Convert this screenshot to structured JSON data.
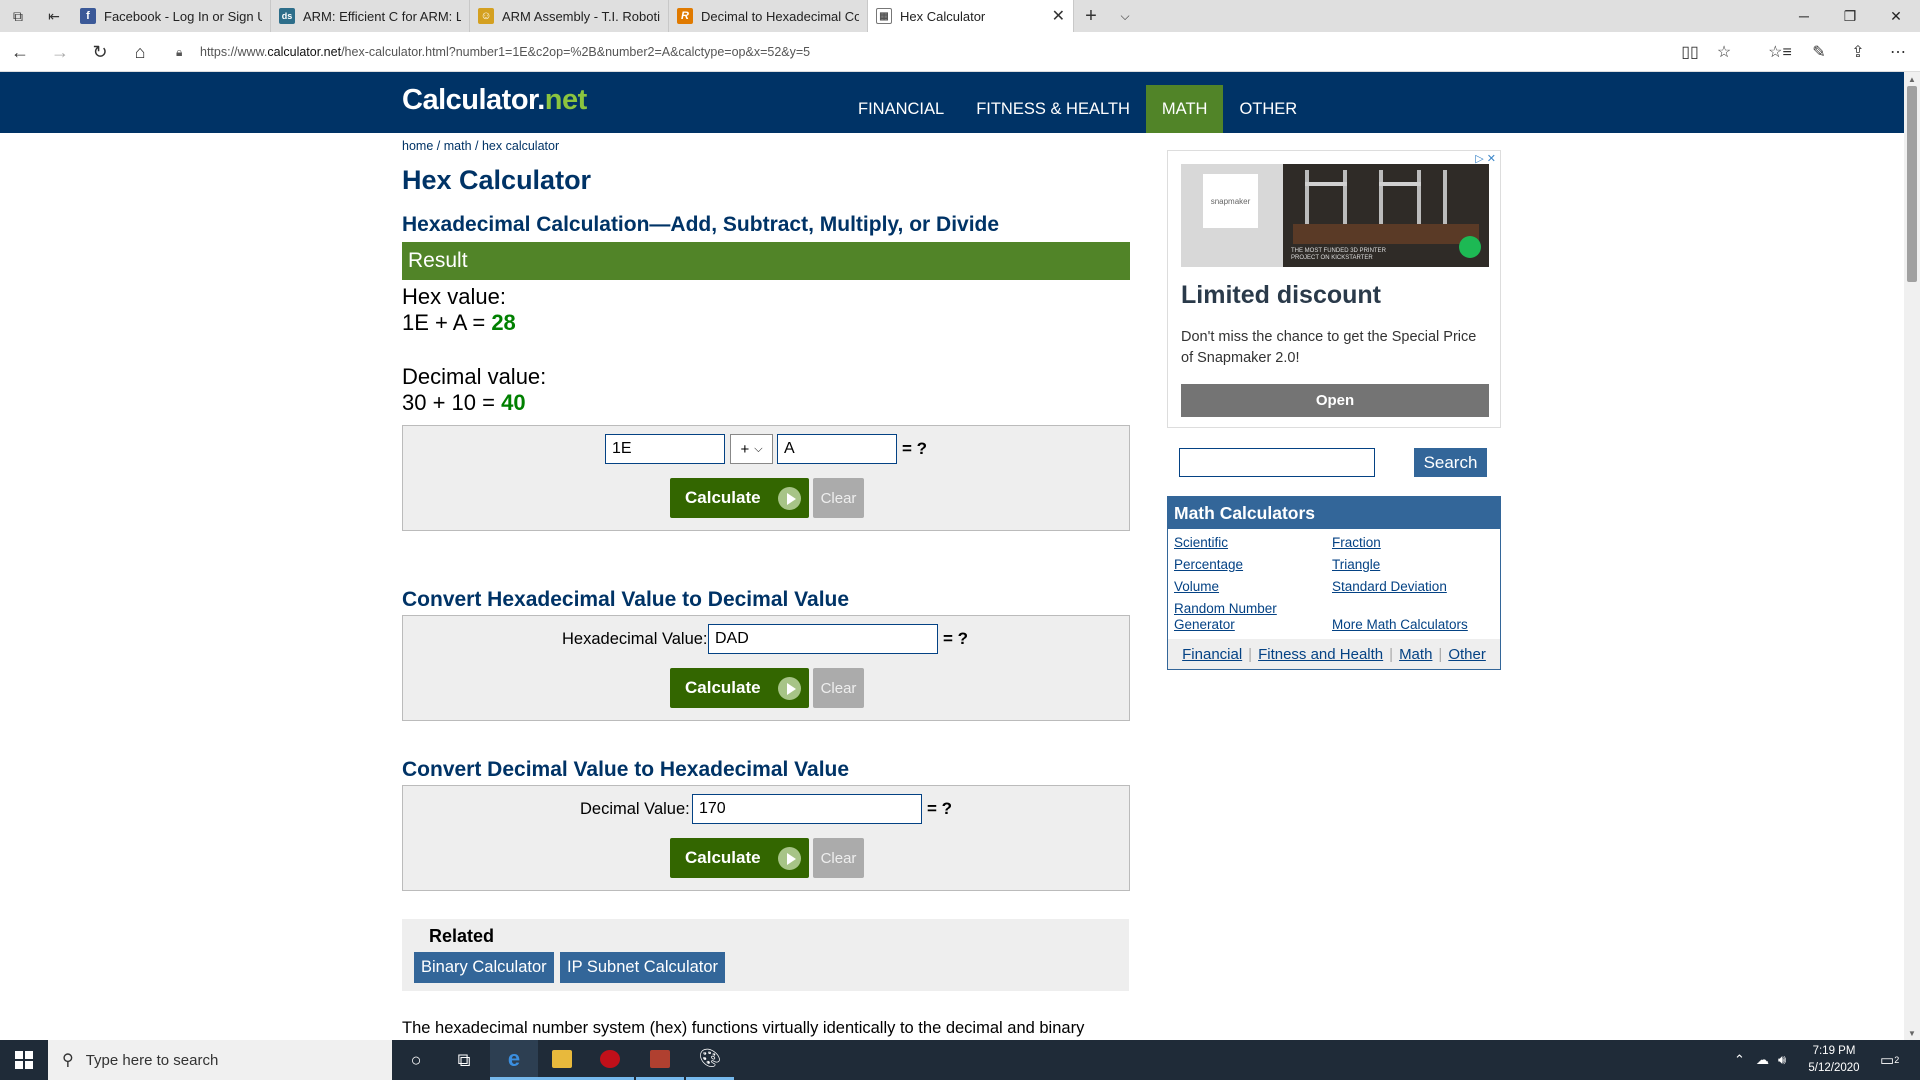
{
  "browser": {
    "tabs": [
      {
        "title": "Facebook - Log In or Sign U",
        "favicon": "facebook-icon",
        "color": "#3b5998",
        "glyph": "f"
      },
      {
        "title": "ARM: Efficient C for ARM: Lc",
        "favicon": "arm-icon",
        "color": "#2d6e8a",
        "glyph": "ds"
      },
      {
        "title": "ARM Assembly - T.I. Robotic",
        "favicon": "robot-icon",
        "color": "#d4a020",
        "glyph": "☺"
      },
      {
        "title": "Decimal to Hexadecimal Co",
        "favicon": "rapidtables-icon",
        "color": "#e07a00",
        "glyph": "R"
      },
      {
        "title": "Hex Calculator",
        "favicon": "calculator-page-icon",
        "color": "#555555",
        "glyph": "▦"
      }
    ],
    "url_prefix": "https://www.",
    "url_domain": "calculator.net",
    "url_path": "/hex-calculator.html?number1=1E&c2op=%2B&number2=A&calctype=op&x=52&y=5"
  },
  "site": {
    "logo_main": "Calculator",
    "logo_dot": ".",
    "logo_net": "net",
    "nav": [
      "FINANCIAL",
      "FITNESS & HEALTH",
      "MATH",
      "OTHER"
    ],
    "nav_active": "MATH"
  },
  "breadcrumb": {
    "home": "home",
    "sep": "/",
    "math": "math",
    "current": "hex calculator"
  },
  "page_title": "Hex Calculator",
  "calc_subtitle": "Hexadecimal Calculation—Add, Subtract, Multiply, or Divide",
  "result": {
    "bar_label": "Result",
    "hex_label": "Hex value:",
    "hex_expr": "1E + A = ",
    "hex_answer": "28",
    "dec_label": "Decimal value:",
    "dec_expr": "30 + 10 = ",
    "dec_answer": "40"
  },
  "calc1": {
    "number1": "1E",
    "operator": "+",
    "number2": "A",
    "equals": "= ?",
    "calculate": "Calculate",
    "clear": "Clear"
  },
  "convert_hex": {
    "title": "Convert Hexadecimal Value to Decimal Value",
    "label": "Hexadecimal Value:",
    "value": "DAD",
    "equals": "= ?",
    "calculate": "Calculate",
    "clear": "Clear"
  },
  "convert_dec": {
    "title": "Convert Decimal Value to Hexadecimal Value",
    "label": "Decimal Value:",
    "value": "170",
    "equals": "= ?",
    "calculate": "Calculate",
    "clear": "Clear"
  },
  "related": {
    "title": "Related",
    "links": [
      "Binary Calculator",
      "IP Subnet Calculator"
    ]
  },
  "intro_text": "The hexadecimal number system (hex) functions virtually identically to the decimal and binary",
  "ad": {
    "brand": "snapmaker",
    "caption1": "THE MOST FUNDED 3D PRINTER",
    "caption2": "PROJECT ON KICKSTARTER",
    "headline": "Limited discount",
    "text": "Don't miss the chance to get the Special Price of Snapmaker 2.0!",
    "button": "Open"
  },
  "side_search": {
    "button": "Search",
    "value": ""
  },
  "math_calculators": {
    "title": "Math Calculators",
    "left": [
      "Scientific",
      "Percentage",
      "Volume",
      "Random Number Generator"
    ],
    "right": [
      "Fraction",
      "Triangle",
      "Standard Deviation",
      "More Math Calculators"
    ],
    "footer": [
      "Financial",
      "Fitness and Health",
      "Math",
      "Other"
    ]
  },
  "taskbar": {
    "search_placeholder": "Type here to search",
    "time": "7:19 PM",
    "date": "5/12/2020",
    "notifications": "2"
  }
}
